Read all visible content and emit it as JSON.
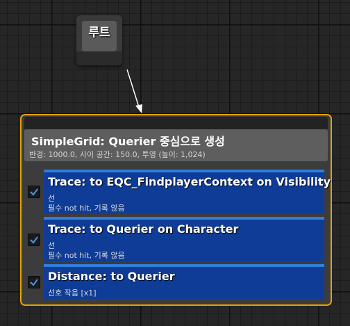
{
  "root_node": {
    "label": "루트"
  },
  "generator": {
    "title": "SimpleGrid: Querier 중심으로 생성",
    "subtitle": "반경: 1000.0, 사이 공간: 150.0, 투영 (높이: 1,024)"
  },
  "tests": [
    {
      "checked": true,
      "title": "Trace: to EQC_FindplayerContext on Visibility",
      "line1": "선",
      "line2": "필수 not hit, 기록 않음"
    },
    {
      "checked": true,
      "title": "Trace: to Querier on Character",
      "line1": "선",
      "line2": "필수 not hit, 기록 않음"
    },
    {
      "checked": true,
      "title": "Distance: to Querier",
      "line1": "선호 작음 [x1]"
    }
  ],
  "colors": {
    "node_border": "#e8a200",
    "test_card": "#0f3c96",
    "test_card_top": "#2f7fdc",
    "check_mark": "#4a90e2"
  }
}
